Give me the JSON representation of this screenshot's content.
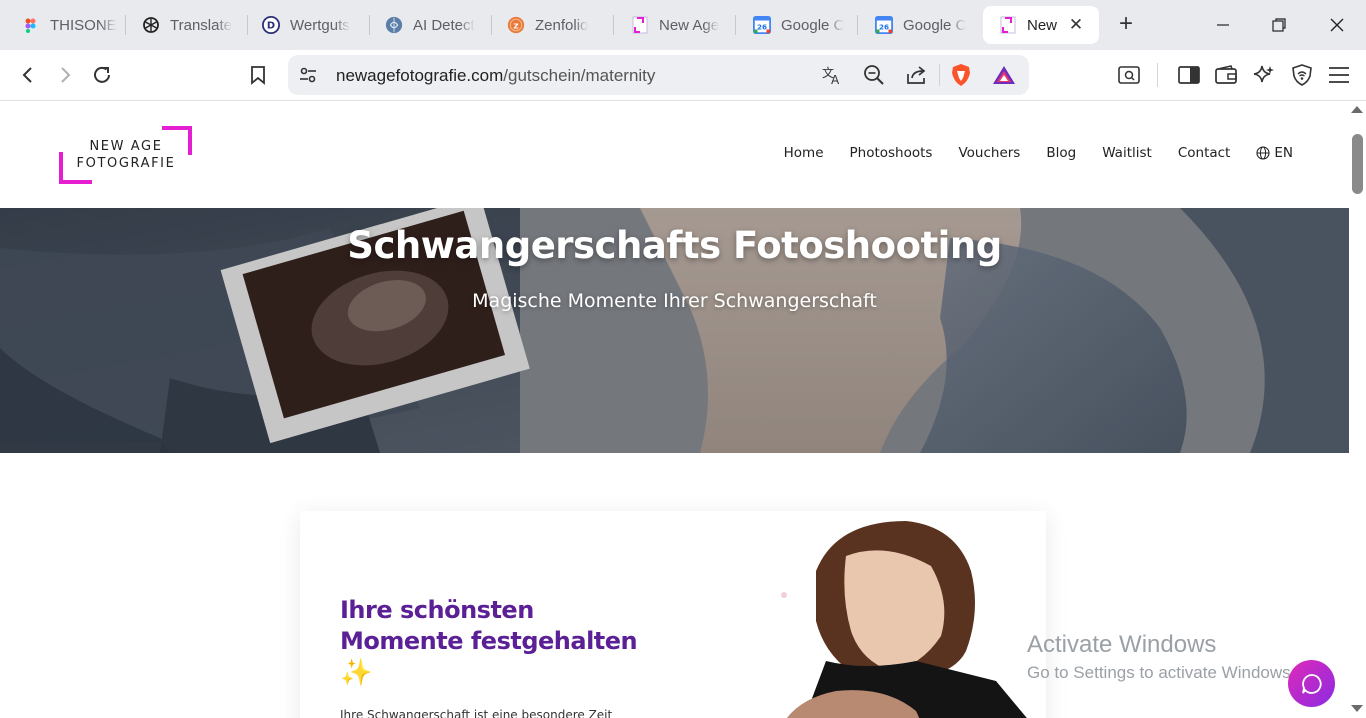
{
  "browser": {
    "tabs": [
      {
        "label": "THISONE",
        "icon": "figma-icon"
      },
      {
        "label": "Translate",
        "icon": "openai-icon"
      },
      {
        "label": "Wertguts",
        "icon": "d-letter-icon"
      },
      {
        "label": "AI Detect",
        "icon": "brain-icon"
      },
      {
        "label": "Zenfolio",
        "icon": "zenfolio-icon"
      },
      {
        "label": "New Age",
        "icon": "newage-favicon"
      },
      {
        "label": "Google C",
        "icon": "google-calendar-icon"
      },
      {
        "label": "Google C",
        "icon": "google-calendar-icon"
      },
      {
        "label": "New",
        "icon": "newage-favicon",
        "active": true
      }
    ],
    "new_tab": "+",
    "url_domain": "newagefotografie.com",
    "url_path": "/gutschein/maternity"
  },
  "site": {
    "logo_line1": "NEW AGE",
    "logo_line2": "FOTOGRAFIE",
    "nav": [
      "Home",
      "Photoshoots",
      "Vouchers",
      "Blog",
      "Waitlist",
      "Contact"
    ],
    "lang": "EN",
    "hero_title": "Schwangerschafts Fotoshooting",
    "hero_subtitle": "Magische Momente Ihrer Schwangerschaft",
    "card_heading": "Ihre schönsten Momente festgehalten",
    "card_emoji": "✨",
    "card_text": "Ihre Schwangerschaft ist eine besondere Zeit"
  },
  "overlay": {
    "watermark_title": "Activate Windows",
    "watermark_sub": "Go to Settings to activate Windows."
  },
  "colors": {
    "brand_magenta": "#e61ed2",
    "heading_purple": "#5b1f96",
    "chat_gradient": [
      "#e02ab8",
      "#8a2be2"
    ]
  }
}
